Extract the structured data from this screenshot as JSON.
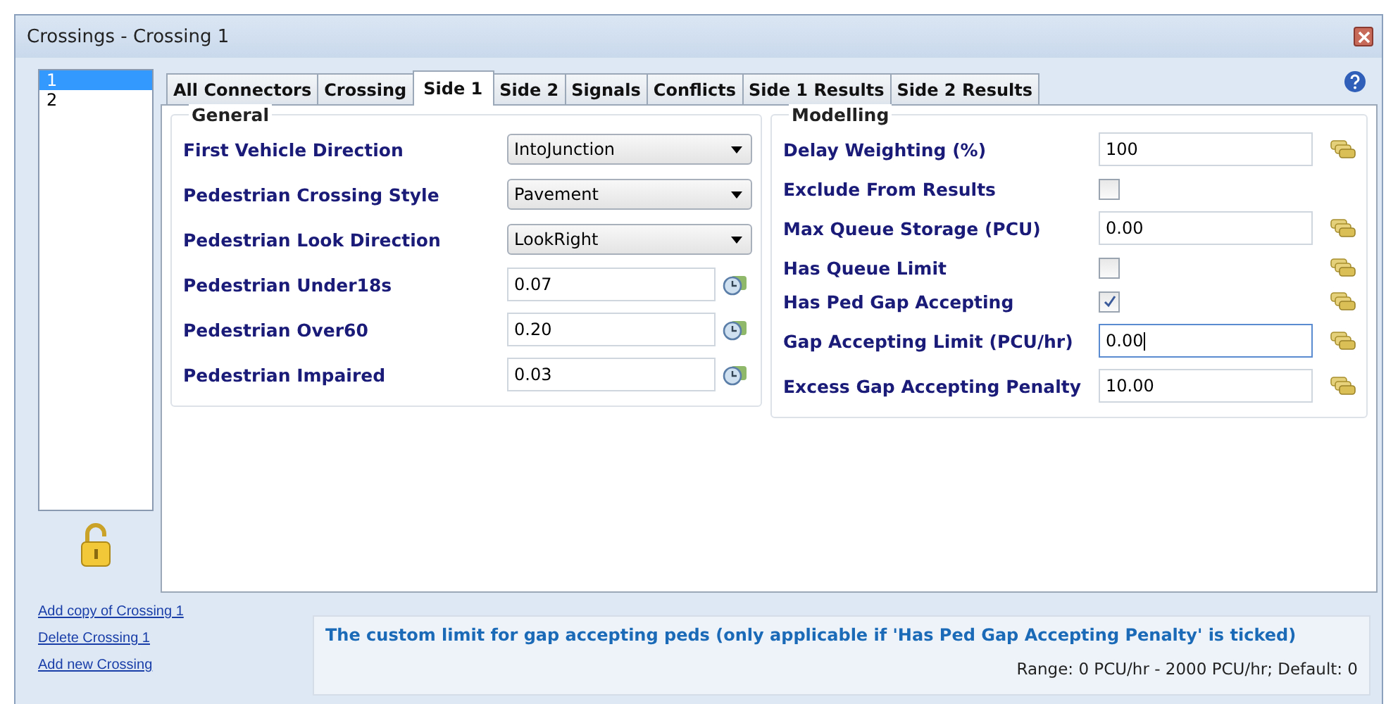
{
  "window": {
    "title": "Crossings - Crossing 1"
  },
  "crossings": [
    {
      "label": "1",
      "selected": true
    },
    {
      "label": "2",
      "selected": false
    }
  ],
  "locked": false,
  "links": [
    "Add copy of Crossing 1",
    "Delete Crossing 1",
    "Add new Crossing"
  ],
  "tabs": [
    {
      "label": "All Connectors",
      "selected": false
    },
    {
      "label": "Crossing",
      "selected": false
    },
    {
      "label": "Side 1",
      "selected": true
    },
    {
      "label": "Side 2",
      "selected": false
    },
    {
      "label": "Signals",
      "selected": false
    },
    {
      "label": "Conflicts",
      "selected": false
    },
    {
      "label": "Side 1 Results",
      "selected": false
    },
    {
      "label": "Side 2 Results",
      "selected": false
    }
  ],
  "general": {
    "title": "General",
    "rows": [
      {
        "kind": "dropdown",
        "label": "First Vehicle Direction",
        "value": "IntoJunction"
      },
      {
        "kind": "dropdown",
        "label": "Pedestrian Crossing Style",
        "value": "Pavement"
      },
      {
        "kind": "dropdown",
        "label": "Pedestrian Look Direction",
        "value": "LookRight"
      },
      {
        "kind": "text",
        "label": "Pedestrian Under18s",
        "value": "0.07"
      },
      {
        "kind": "text",
        "label": "Pedestrian Over60",
        "value": "0.20"
      },
      {
        "kind": "text",
        "label": "Pedestrian Impaired",
        "value": "0.03"
      }
    ]
  },
  "modelling": {
    "title": "Modelling",
    "rows": [
      {
        "kind": "text",
        "label": "Delay Weighting (%)",
        "value": "100",
        "focused": false,
        "data_button": true
      },
      {
        "kind": "checkbox",
        "label": "Exclude From Results",
        "checked": false,
        "data_button": false
      },
      {
        "kind": "text",
        "label": "Max Queue Storage (PCU)",
        "value": "0.00",
        "focused": false,
        "data_button": true
      },
      {
        "kind": "checkbox",
        "label": "Has Queue Limit",
        "checked": false,
        "data_button": true
      },
      {
        "kind": "checkbox",
        "label": "Has Ped Gap Accepting",
        "checked": true,
        "data_button": true
      },
      {
        "kind": "text",
        "label": "Gap Accepting Limit (PCU/hr)",
        "value": "0.00",
        "focused": true,
        "data_button": true
      },
      {
        "kind": "text",
        "label": "Excess Gap Accepting Penalty",
        "value": "10.00",
        "focused": false,
        "data_button": true
      }
    ]
  },
  "hint": {
    "description": "The custom limit for gap accepting peds (only applicable if 'Has Ped Gap Accepting Penalty' is ticked)",
    "range": "Range: 0 PCU/hr - 2000 PCU/hr; Default: 0"
  }
}
